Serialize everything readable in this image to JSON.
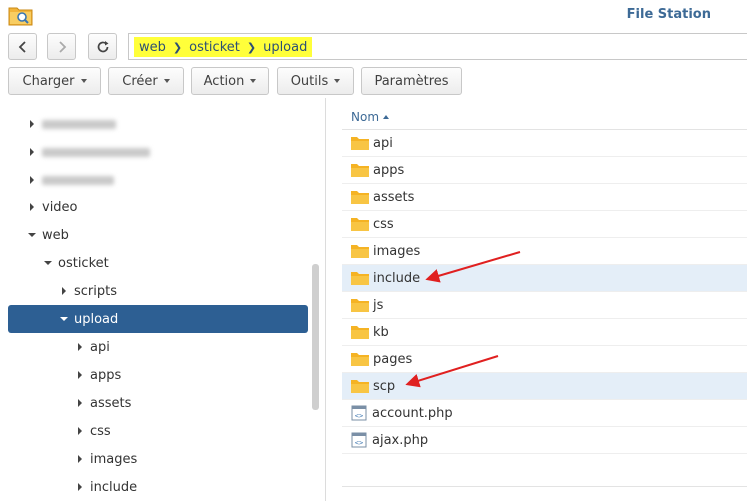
{
  "window": {
    "title": "File Station"
  },
  "path": {
    "crumbs": [
      "web",
      "osticket",
      "upload"
    ]
  },
  "toolbar": {
    "charger": "Charger",
    "creer": "Créer",
    "action": "Action",
    "outils": "Outils",
    "parametres": "Paramètres"
  },
  "tree": {
    "items": [
      {
        "label": "video"
      },
      {
        "label": "web"
      },
      {
        "label": "osticket"
      },
      {
        "label": "scripts"
      },
      {
        "label": "upload"
      },
      {
        "label": "api"
      },
      {
        "label": "apps"
      },
      {
        "label": "assets"
      },
      {
        "label": "css"
      },
      {
        "label": "images"
      },
      {
        "label": "include"
      }
    ]
  },
  "list": {
    "header": "Nom",
    "rows": [
      {
        "name": "api"
      },
      {
        "name": "apps"
      },
      {
        "name": "assets"
      },
      {
        "name": "css"
      },
      {
        "name": "images"
      },
      {
        "name": "include"
      },
      {
        "name": "js"
      },
      {
        "name": "kb"
      },
      {
        "name": "pages"
      },
      {
        "name": "scp"
      },
      {
        "name": "account.php"
      },
      {
        "name": "ajax.php"
      }
    ]
  },
  "colors": {
    "accent": "#2d5f93",
    "highlight": "#ffff3a",
    "folder": "#f5b324",
    "annotation": "#e02020"
  }
}
